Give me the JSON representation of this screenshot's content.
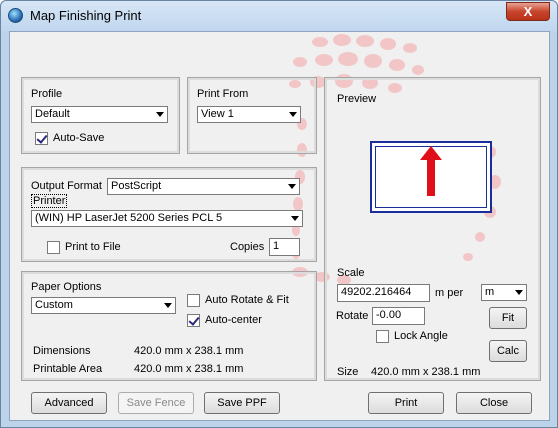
{
  "window": {
    "title": "Map Finishing Print",
    "close_glyph": "X"
  },
  "profile": {
    "label": "Profile",
    "value": "Default",
    "autosave_label": "Auto-Save",
    "autosave_checked": true
  },
  "print_from": {
    "label": "Print From",
    "value": "View 1"
  },
  "output": {
    "format_label": "Output Format",
    "format_value": "PostScript",
    "printer_label": "Printer",
    "printer_value": "(WIN)  HP LaserJet 5200 Series PCL 5",
    "print_to_file_label": "Print to File",
    "print_to_file_checked": false,
    "copies_label": "Copies",
    "copies_value": "1"
  },
  "paper": {
    "label": "Paper Options",
    "value": "Custom",
    "auto_rotate_label": "Auto Rotate & Fit",
    "auto_rotate_checked": false,
    "auto_center_label": "Auto-center",
    "auto_center_checked": true,
    "dimensions_label": "Dimensions",
    "dimensions_value": "420.0 mm x 238.1 mm",
    "printable_label": "Printable Area",
    "printable_value": "420.0 mm x 238.1 mm"
  },
  "preview": {
    "label": "Preview",
    "scale_label": "Scale",
    "scale_value": "49202.216464",
    "per_label": "m per",
    "unit_value": "m",
    "fit_label": "Fit",
    "rotate_label": "Rotate",
    "rotate_value": "-0.00",
    "lock_angle_label": "Lock Angle",
    "lock_angle_checked": false,
    "calc_label": "Calc",
    "size_label": "Size",
    "size_value": "420.0 mm x 238.1 mm"
  },
  "buttons": {
    "advanced": "Advanced",
    "save_fence": "Save Fence",
    "save_ppf": "Save PPF",
    "print": "Print",
    "close": "Close"
  },
  "colors": {
    "arrow": "#e0101a",
    "preview_border": "#1a2d9a",
    "watermark": "#f2c6c6"
  },
  "icons": {
    "app": "globe-icon",
    "arrow": "up-arrow-icon"
  }
}
